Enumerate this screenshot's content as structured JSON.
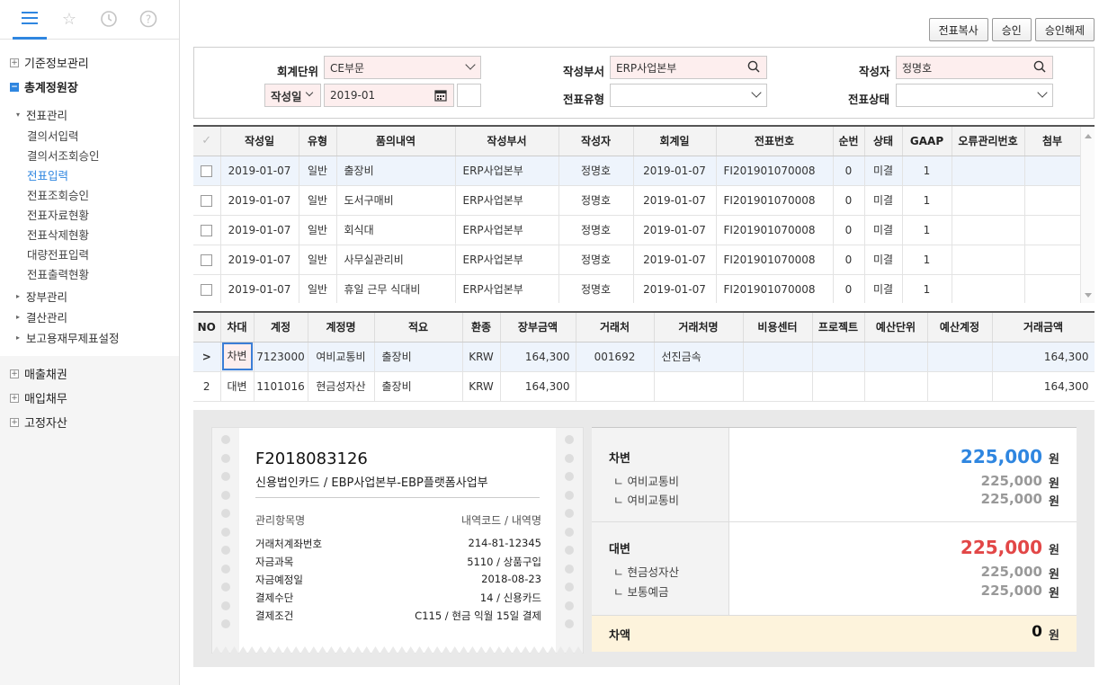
{
  "sidebar": {
    "icons": [
      "menu-icon",
      "star-icon",
      "history-icon",
      "help-icon"
    ],
    "groups_top": [
      {
        "label": "기준정보관리",
        "state": "+"
      }
    ],
    "open_group": {
      "label": "총계정원장",
      "state": "−"
    },
    "sub_groups": [
      {
        "label": "전표관리",
        "open": true
      }
    ],
    "items": [
      "결의서입력",
      "결의서조회승인",
      "전표입력",
      "전표조회승인",
      "전표자료현황",
      "전표삭제현황",
      "대량전표입력",
      "전표출력현황"
    ],
    "selected_item": "전표입력",
    "sub_groups_after": [
      "장부관리",
      "결산관리",
      "보고용재무제표설정"
    ],
    "groups_bottom": [
      "매출채권",
      "매입채무",
      "고정자산"
    ]
  },
  "toolbar": {
    "copy": "전표복사",
    "approve": "승인",
    "unapprove": "승인해제"
  },
  "search": {
    "unit_label": "회계단위",
    "unit_value": "CE부문",
    "dept_label": "작성부서",
    "dept_value": "ERP사업본부",
    "writer_label": "작성자",
    "writer_value": "정명호",
    "date_type": "작성일",
    "date_value": "2019-01",
    "type_label": "전표유형",
    "type_value": "",
    "status_label": "전표상태",
    "status_value": ""
  },
  "grid1": {
    "headers": [
      "작성일",
      "유형",
      "품의내역",
      "작성부서",
      "작성자",
      "회계일",
      "전표번호",
      "순번",
      "상태",
      "GAAP",
      "오류관리번호",
      "첨부"
    ],
    "rows": [
      [
        "2019-01-07",
        "일반",
        "출장비",
        "ERP사업본부",
        "정명호",
        "2019-01-07",
        "FI201901070008",
        "0",
        "미결",
        "1",
        "",
        ""
      ],
      [
        "2019-01-07",
        "일반",
        "도서구매비",
        "ERP사업본부",
        "정명호",
        "2019-01-07",
        "FI201901070008",
        "0",
        "미결",
        "1",
        "",
        ""
      ],
      [
        "2019-01-07",
        "일반",
        "회식대",
        "ERP사업본부",
        "정명호",
        "2019-01-07",
        "FI201901070008",
        "0",
        "미결",
        "1",
        "",
        ""
      ],
      [
        "2019-01-07",
        "일반",
        "사무실관리비",
        "ERP사업본부",
        "정명호",
        "2019-01-07",
        "FI201901070008",
        "0",
        "미결",
        "1",
        "",
        ""
      ],
      [
        "2019-01-07",
        "일반",
        "휴일 근무 식대비",
        "ERP사업본부",
        "정명호",
        "2019-01-07",
        "FI201901070008",
        "0",
        "미결",
        "1",
        "",
        ""
      ]
    ]
  },
  "grid2": {
    "headers": [
      "NO",
      "차대",
      "계정",
      "계정명",
      "적요",
      "환종",
      "장부금액",
      "거래처",
      "거래처명",
      "비용센터",
      "프로젝트",
      "예산단위",
      "예산계정",
      "거래금액"
    ],
    "rows": [
      [
        ">",
        "차변",
        "7123000",
        "여비교통비",
        "출장비",
        "KRW",
        "164,300",
        "001692",
        "선진금속",
        "",
        "",
        "",
        "",
        "164,300"
      ],
      [
        "2",
        "대변",
        "1101016",
        "현금성자산",
        "출장비",
        "KRW",
        "164,300",
        "",
        "",
        "",
        "",
        "",
        "",
        "164,300"
      ]
    ]
  },
  "receipt": {
    "number": "F2018083126",
    "subtitle": "신용법인카드 / EBP사업본부-EBP플랫폼사업부",
    "head_left": "관리항목명",
    "head_right": "내역코드 / 내역명",
    "rows": [
      {
        "k": "거래처계좌번호",
        "v": "214-81-12345"
      },
      {
        "k": "자금과목",
        "v": "5110 / 상품구입"
      },
      {
        "k": "자금예정일",
        "v": "2018-08-23"
      },
      {
        "k": "결제수단",
        "v": "14 / 신용카드"
      },
      {
        "k": "결제조건",
        "v": "C115 / 현금 익월 15일 결제"
      }
    ]
  },
  "summary": {
    "unit": "원",
    "debit": {
      "title": "차변",
      "total": "225,000",
      "items": [
        {
          "name": "ㄴ 여비교통비",
          "amount": "225,000"
        },
        {
          "name": "ㄴ 여비교통비",
          "amount": "225,000"
        }
      ]
    },
    "credit": {
      "title": "대변",
      "total": "225,000",
      "items": [
        {
          "name": "ㄴ 현금성자산",
          "amount": "225,000"
        },
        {
          "name": "ㄴ 보통예금",
          "amount": "225,000"
        }
      ]
    },
    "diff": {
      "title": "차액",
      "total": "0"
    }
  },
  "colors": {
    "accent": "#2f86e0",
    "debit": "#2f86e0",
    "credit": "#e24747",
    "required_bg": "#fdeeee",
    "diff_bg": "#fdf3dc"
  }
}
